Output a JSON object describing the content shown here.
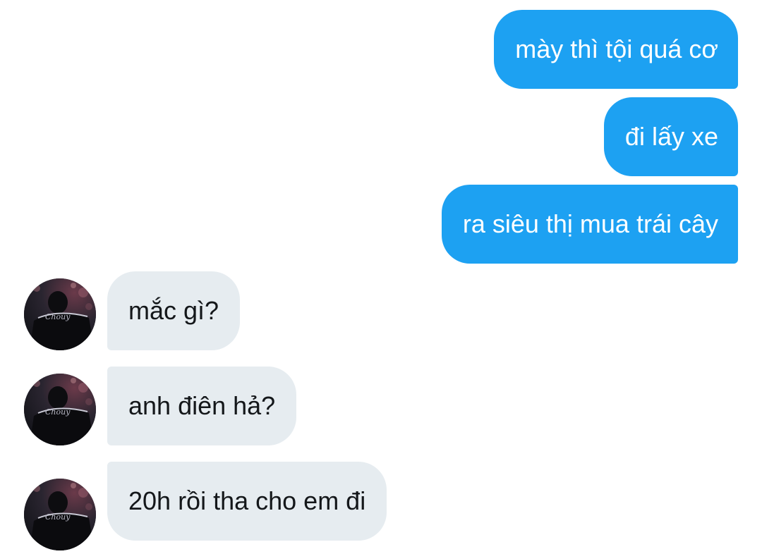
{
  "conversation": {
    "sent_messages": [
      {
        "text": "mày thì tội quá cơ"
      },
      {
        "text": "đi lấy xe"
      },
      {
        "text": "ra siêu thị mua trái cây"
      }
    ],
    "received_messages": [
      {
        "text": "mắc gì?"
      },
      {
        "text": "anh điên hả?"
      },
      {
        "text": "20h rồi tha cho em đi"
      }
    ],
    "avatar_icon": "user-avatar-photo",
    "avatar_caption": "Chouy"
  },
  "colors": {
    "sent_bubble": "#1da1f2",
    "sent_text": "#ffffff",
    "received_bubble": "#e6ecf0",
    "received_text": "#14171a",
    "background": "#ffffff"
  }
}
